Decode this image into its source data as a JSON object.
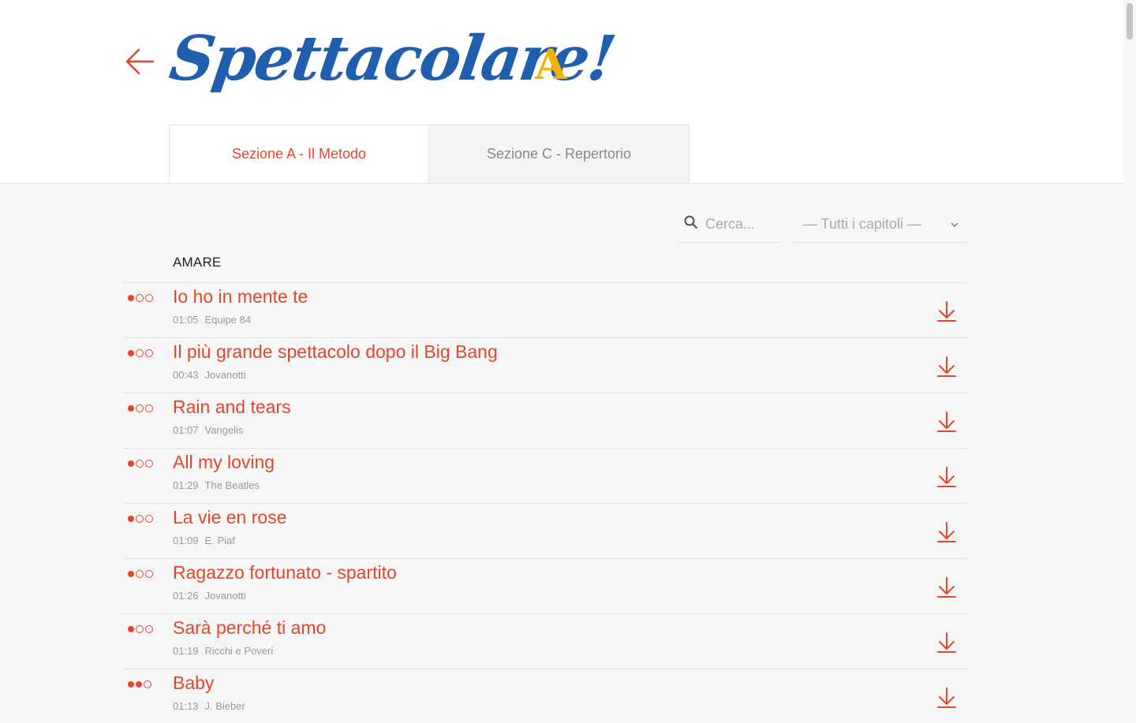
{
  "header": {
    "logo_text": "Spettacolare!",
    "logo_letter": "A"
  },
  "tabs": [
    {
      "label": "Sezione A - Il Metodo",
      "active": true
    },
    {
      "label": "Sezione C - Repertorio",
      "active": false
    }
  ],
  "filters": {
    "search_placeholder": "Cerca...",
    "chapter_select": "— Tutti i capitoli —"
  },
  "section": {
    "title": "AMARE"
  },
  "songs": [
    {
      "title": "Io ho in mente te",
      "duration": "01:05",
      "artist": "Equipe 84",
      "level": 1
    },
    {
      "title": "Il più grande spettacolo dopo il Big Bang",
      "duration": "00:43",
      "artist": "Jovanotti",
      "level": 1
    },
    {
      "title": "Rain and tears",
      "duration": "01:07",
      "artist": "Vangelis",
      "level": 1
    },
    {
      "title": "All my loving",
      "duration": "01:29",
      "artist": "The Beatles",
      "level": 1
    },
    {
      "title": "La vie en rose",
      "duration": "01:09",
      "artist": "E. Piaf",
      "level": 1
    },
    {
      "title": "Ragazzo fortunato - spartito",
      "duration": "01:26",
      "artist": "Jovanotti",
      "level": 1
    },
    {
      "title": "Sarà perché ti amo",
      "duration": "01:19",
      "artist": "Ricchi e Poveri",
      "level": 1
    },
    {
      "title": "Baby",
      "duration": "01:13",
      "artist": "J. Bieber",
      "level": 2
    }
  ],
  "colors": {
    "accent": "#e2462f",
    "logo_blue": "#1f5fae",
    "logo_yellow": "#f2b400"
  }
}
